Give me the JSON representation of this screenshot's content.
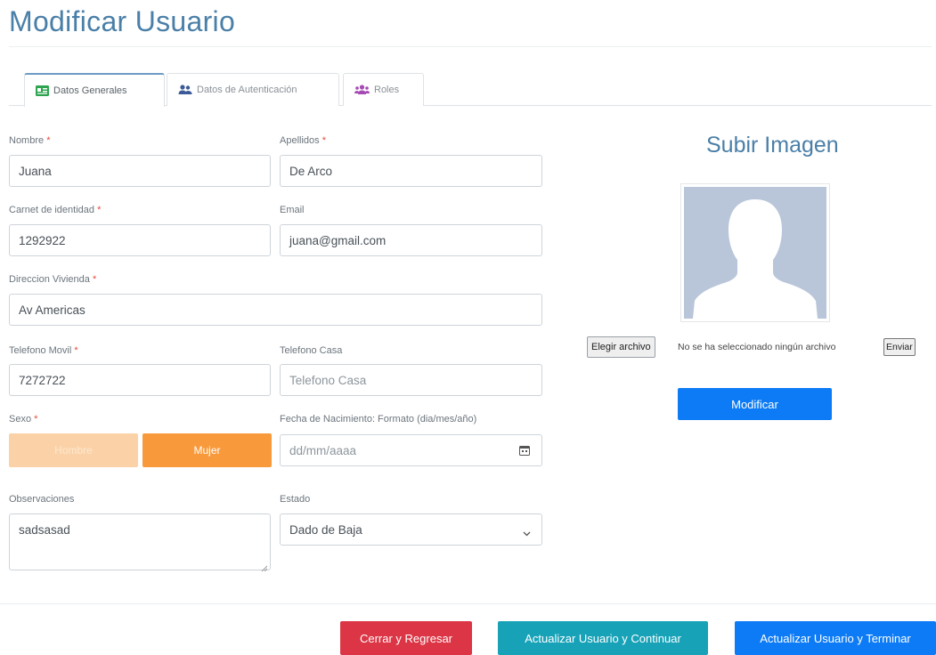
{
  "page": {
    "title": "Modificar Usuario"
  },
  "tabs": [
    {
      "label": "Datos Generales",
      "icon": "id-card-icon",
      "active": true
    },
    {
      "label": "Datos de Autenticación",
      "icon": "users-icon",
      "active": false
    },
    {
      "label": "Roles",
      "icon": "user-group-icon",
      "active": false
    }
  ],
  "form": {
    "nombre": {
      "label": "Nombre",
      "required": "*",
      "value": "Juana"
    },
    "apellidos": {
      "label": "Apellidos",
      "required": "*",
      "value": "De Arco"
    },
    "carnet": {
      "label": "Carnet de identidad",
      "required": "*",
      "value": "1292922"
    },
    "email": {
      "label": "Email",
      "value": "juana@gmail.com"
    },
    "direccion": {
      "label": "Direccion Vivienda",
      "required": "*",
      "value": "Av Americas"
    },
    "movil": {
      "label": "Telefono Movil",
      "required": "*",
      "value": "7272722"
    },
    "casa": {
      "label": "Telefono Casa",
      "placeholder": "Telefono Casa"
    },
    "sexo": {
      "label": "Sexo",
      "required": "*",
      "options": [
        "Hombre",
        "Mujer"
      ],
      "selected": "Mujer"
    },
    "fecha": {
      "label": "Fecha de Nacimiento: Formato (dia/mes/año)",
      "placeholder": "dd/mm/aaaa"
    },
    "observaciones": {
      "label": "Observaciones",
      "value": "sadsasad"
    },
    "estado": {
      "label": "Estado",
      "value": "Dado de Baja"
    }
  },
  "upload": {
    "title": "Subir Imagen",
    "file_button": "Elegir archivo",
    "file_status": "No se ha seleccionado ningún archivo",
    "send_button": "Enviar",
    "submit_label": "Modificar"
  },
  "footer": {
    "close_label": "Cerrar y Regresar",
    "continue_label": "Actualizar Usuario y Continuar",
    "finish_label": "Actualizar Usuario y Terminar"
  },
  "colors": {
    "title": "#4a7fa8",
    "primary": "#0d7bf5",
    "danger": "#dc3545",
    "info": "#17a2b8",
    "sex_selected": "#f89a3c",
    "sex_unselected": "#fbd2a8"
  }
}
